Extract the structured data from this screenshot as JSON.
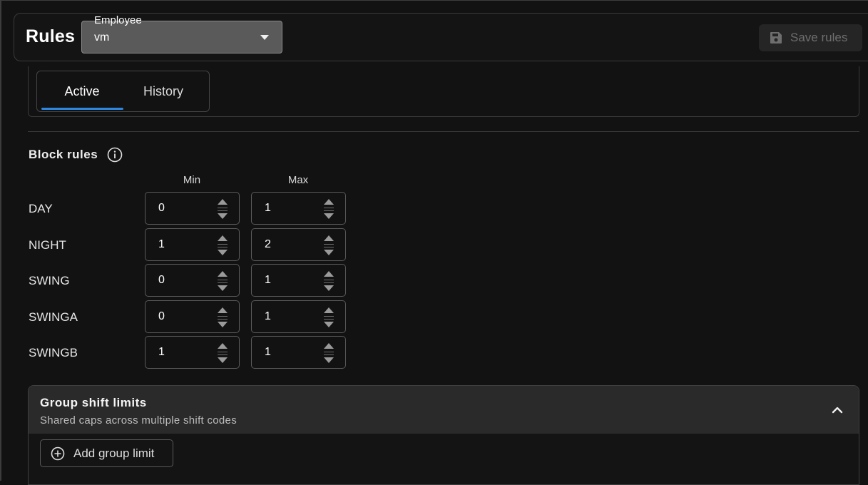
{
  "header": {
    "title": "Rules",
    "employee_select": {
      "label": "Employee",
      "value": "vm"
    },
    "save_label": "Save rules",
    "save_icon": "floppy-disk-icon"
  },
  "tabs": [
    {
      "label": "Active",
      "selected": true
    },
    {
      "label": "History",
      "selected": false
    }
  ],
  "block_rules": {
    "title": "Block rules",
    "info_icon": "info-icon",
    "columns": {
      "min": "Min",
      "max": "Max"
    },
    "rows": [
      {
        "code": "DAY",
        "min": "0",
        "max": "1"
      },
      {
        "code": "NIGHT",
        "min": "1",
        "max": "2"
      },
      {
        "code": "SWING",
        "min": "0",
        "max": "1"
      },
      {
        "code": "SWINGA",
        "min": "0",
        "max": "1"
      },
      {
        "code": "SWINGB",
        "min": "1",
        "max": "1"
      }
    ]
  },
  "group_limits": {
    "title": "Group shift limits",
    "subtitle": "Shared caps across multiple shift codes",
    "expanded": true,
    "add_label": "Add group limit"
  },
  "colors": {
    "background": "#121212",
    "accent": "#2f86e0",
    "select_bg": "#5a5a5a"
  }
}
